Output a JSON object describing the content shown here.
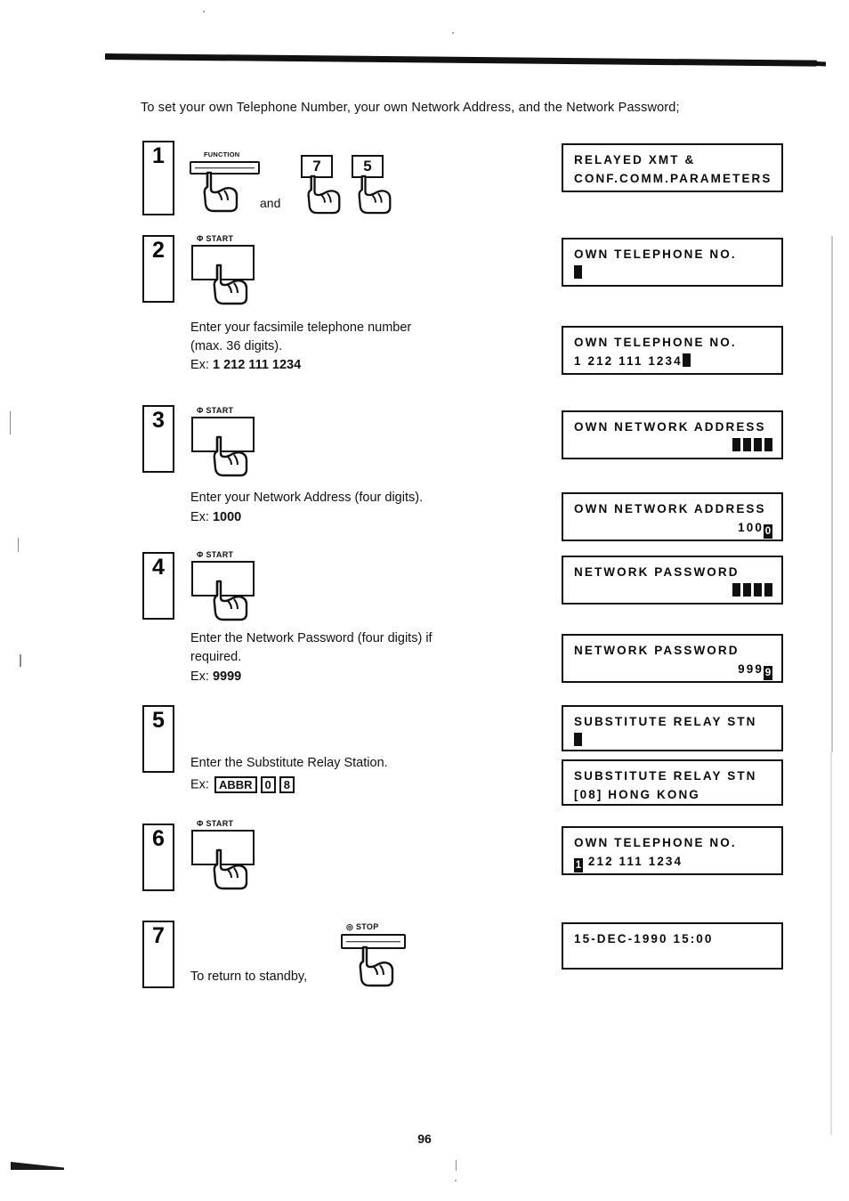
{
  "page": {
    "intro": "To set your own Telephone Number, your own Network Address, and the Network Password;",
    "page_number": "96"
  },
  "keys": {
    "function_label": "FUNCTION",
    "start_label": "Φ START",
    "stop_label": "◎ STOP",
    "key_seven": "7",
    "key_five": "5",
    "and_word": "and"
  },
  "steps": [
    {
      "number": "1",
      "text": "",
      "example": ""
    },
    {
      "number": "2",
      "text": "Enter  your  facsimile  telephone  number\n(max. 36 digits).",
      "example_prefix": "Ex: ",
      "example": "1 212 111 1234"
    },
    {
      "number": "3",
      "text": "Enter your Network Address (four digits).",
      "example_prefix": "Ex: ",
      "example": "1000"
    },
    {
      "number": "4",
      "text": "Enter  the  Network  Password  (four digits)  if\nrequired.",
      "example_prefix": "Ex: ",
      "example": "9999"
    },
    {
      "number": "5",
      "text": "Enter the Substitute Relay Station.",
      "example_prefix": "Ex: ",
      "example_keys": [
        "ABBR",
        "0",
        "8"
      ]
    },
    {
      "number": "6",
      "text": "",
      "example": ""
    },
    {
      "number": "7",
      "text": "To return to standby,",
      "example": ""
    }
  ],
  "displays": [
    {
      "id": "relayed-xmt-params",
      "line1": "RELAYED XMT &",
      "line2": "CONF.COMM.PARAMETERS",
      "line2_align": "left",
      "cursor": "none"
    },
    {
      "id": "own-telephone-no-empty",
      "line1": "OWN TELEPHONE NO.",
      "line2": "",
      "line2_align": "left",
      "cursor": "lead-block"
    },
    {
      "id": "own-telephone-no-entered",
      "line1": "OWN TELEPHONE NO.",
      "line2": "1 212 111 1234",
      "line2_align": "left",
      "cursor": "trail-block"
    },
    {
      "id": "own-network-address-empty",
      "line1": "OWN NETWORK ADDRESS",
      "line2": "",
      "line2_align": "right",
      "cursor": "four-blocks"
    },
    {
      "id": "own-network-address-entered",
      "line1": "OWN NETWORK ADDRESS",
      "line2": "100",
      "line2_align": "right",
      "cursor": "inverted-char",
      "cursor_char": "0"
    },
    {
      "id": "network-password-empty",
      "line1": "NETWORK PASSWORD",
      "line2": "",
      "line2_align": "right",
      "cursor": "four-blocks"
    },
    {
      "id": "network-password-entered",
      "line1": "NETWORK PASSWORD",
      "line2": "999",
      "line2_align": "right",
      "cursor": "inverted-char",
      "cursor_char": "9"
    },
    {
      "id": "substitute-relay-stn-empty",
      "line1": "SUBSTITUTE RELAY STN",
      "line2": "",
      "line2_align": "left",
      "cursor": "lead-block"
    },
    {
      "id": "substitute-relay-stn-entered",
      "line1": "SUBSTITUTE RELAY STN",
      "line2": "[08] HONG KONG",
      "line2_align": "left",
      "cursor": "none"
    },
    {
      "id": "own-telephone-no-confirm",
      "line1": "OWN TELEPHONE NO.",
      "line2": " 212 111 1234",
      "line2_align": "left",
      "cursor": "inverted-lead",
      "cursor_char": "1"
    },
    {
      "id": "standby-clock",
      "line1": "15-DEC-1990 15:00",
      "line2": "",
      "line2_align": "left",
      "cursor": "none"
    }
  ],
  "colors": {
    "ink": "#111111",
    "paper": "#ffffff"
  }
}
